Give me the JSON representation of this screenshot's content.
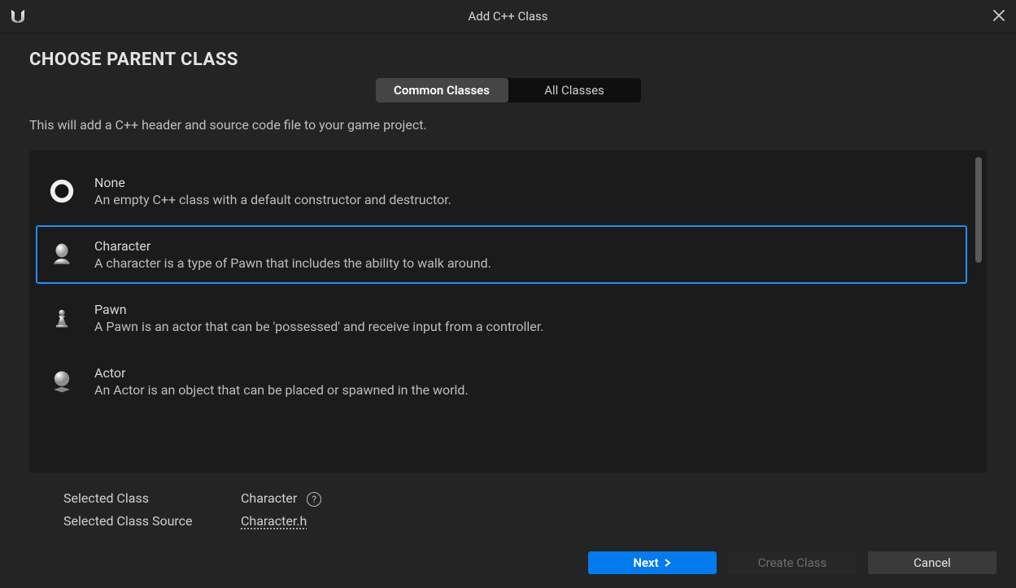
{
  "window": {
    "title": "Add C++ Class"
  },
  "page": {
    "heading": "CHOOSE PARENT CLASS",
    "description": "This will add a C++ header and source code file to your game project."
  },
  "tabs": {
    "common": "Common Classes",
    "all": "All Classes",
    "active": "common"
  },
  "classes": [
    {
      "id": "none",
      "name": "None",
      "desc": "An empty C++ class with a default constructor and destructor.",
      "selected": false,
      "icon": "circle-hole"
    },
    {
      "id": "character",
      "name": "Character",
      "desc": "A character is a type of Pawn that includes the ability to walk around.",
      "selected": true,
      "icon": "person-head"
    },
    {
      "id": "pawn",
      "name": "Pawn",
      "desc": "A Pawn is an actor that can be 'possessed' and receive input from a controller.",
      "selected": false,
      "icon": "chess-pawn"
    },
    {
      "id": "actor",
      "name": "Actor",
      "desc": "An Actor is an object that can be placed or spawned in the world.",
      "selected": false,
      "icon": "sphere-pedestal"
    }
  ],
  "selection": {
    "label_class": "Selected Class",
    "label_source": "Selected Class Source",
    "class_value": "Character",
    "source_value": "Character.h"
  },
  "buttons": {
    "next": "Next",
    "create": "Create Class",
    "cancel": "Cancel"
  }
}
